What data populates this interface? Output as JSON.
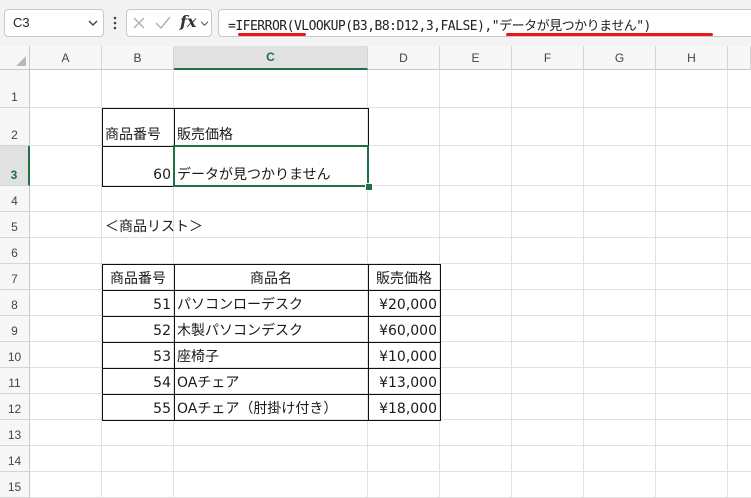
{
  "formula_bar": {
    "name_box": "C3",
    "fx_label": "fx",
    "formula_text": "=IFERROR(VLOOKUP(B3,B8:D12,3,FALSE),\"データが見つかりません\")"
  },
  "columns": [
    "A",
    "B",
    "C",
    "D",
    "E",
    "F",
    "G",
    "H"
  ],
  "rows": [
    "1",
    "2",
    "3",
    "4",
    "5",
    "6",
    "7",
    "8",
    "9",
    "10",
    "11",
    "12",
    "13",
    "14",
    "15"
  ],
  "selected_cell": "C3",
  "lookup": {
    "header_b": "商品番号",
    "header_c": "販売価格",
    "input_value": "60",
    "result": "データが見つかりません"
  },
  "list_title": "＜商品リスト＞",
  "table": {
    "headers": [
      "商品番号",
      "商品名",
      "販売価格"
    ],
    "rows": [
      [
        "51",
        "パソコンローデスク",
        "¥20,000"
      ],
      [
        "52",
        "木製パソコンデスク",
        "¥60,000"
      ],
      [
        "53",
        "座椅子",
        "¥10,000"
      ],
      [
        "54",
        "OAチェア",
        "¥13,000"
      ],
      [
        "55",
        "OAチェア（肘掛け付き）",
        "¥18,000"
      ]
    ]
  },
  "colors": {
    "selection": "#1e7145",
    "underline": "#e8161c"
  },
  "icons": [
    "chevron-down-icon",
    "more-options-icon",
    "cancel-x-icon",
    "confirm-check-icon",
    "insert-function-icon"
  ]
}
